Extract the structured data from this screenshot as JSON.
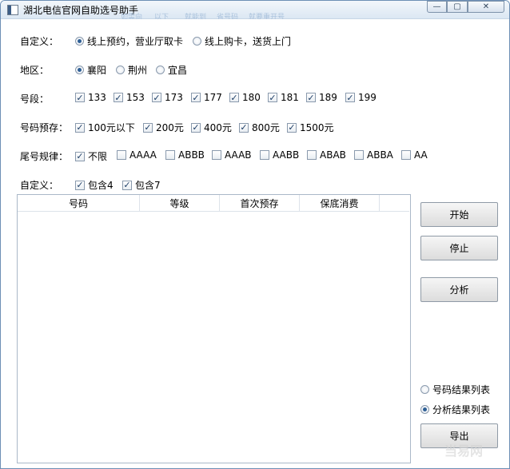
{
  "window": {
    "title": "湖北电信官网自助选号助手",
    "faded_menu": [
      "如需向",
      "以下",
      "就能到",
      "省号码",
      "就要重开号"
    ],
    "controls": {
      "minimize": "—",
      "maximize": "▢",
      "close": "✕"
    }
  },
  "custom_mode": {
    "label": "自定义：",
    "options": [
      {
        "label": "线上预约，营业厅取卡",
        "selected": true
      },
      {
        "label": "线上购卡，送货上门",
        "selected": false
      }
    ]
  },
  "region": {
    "label": "地区：",
    "options": [
      {
        "label": "襄阳",
        "selected": true
      },
      {
        "label": "荆州",
        "selected": false
      },
      {
        "label": "宜昌",
        "selected": false
      }
    ]
  },
  "prefix": {
    "label": "号段：",
    "options": [
      {
        "label": "133",
        "checked": true
      },
      {
        "label": "153",
        "checked": true
      },
      {
        "label": "173",
        "checked": true
      },
      {
        "label": "177",
        "checked": true
      },
      {
        "label": "180",
        "checked": true
      },
      {
        "label": "181",
        "checked": true
      },
      {
        "label": "189",
        "checked": true
      },
      {
        "label": "199",
        "checked": true
      }
    ]
  },
  "prestore": {
    "label": "号码预存：",
    "options": [
      {
        "label": "100元以下",
        "checked": true
      },
      {
        "label": "200元",
        "checked": true
      },
      {
        "label": "400元",
        "checked": true
      },
      {
        "label": "800元",
        "checked": true
      },
      {
        "label": "1500元",
        "checked": true
      }
    ]
  },
  "tail_rule": {
    "label": "尾号规律：",
    "options": [
      {
        "label": "不限",
        "checked": true
      },
      {
        "label": "AAAA",
        "checked": false
      },
      {
        "label": "ABBB",
        "checked": false
      },
      {
        "label": "AAAB",
        "checked": false
      },
      {
        "label": "AABB",
        "checked": false
      },
      {
        "label": "ABAB",
        "checked": false
      },
      {
        "label": "ABBA",
        "checked": false
      },
      {
        "label": "AA",
        "checked": false
      }
    ]
  },
  "custom_filter": {
    "label": "自定义：",
    "options": [
      {
        "label": "包含4",
        "checked": true
      },
      {
        "label": "包含7",
        "checked": true
      }
    ]
  },
  "result_table": {
    "columns": [
      "号码",
      "等级",
      "首次预存",
      "保底消费"
    ],
    "rows": []
  },
  "buttons": {
    "start": "开始",
    "stop": "停止",
    "analyze": "分析",
    "export": "导出"
  },
  "output_mode": {
    "options": [
      {
        "label": "号码结果列表",
        "selected": false
      },
      {
        "label": "分析结果列表",
        "selected": true
      }
    ]
  },
  "watermark": "当易网"
}
